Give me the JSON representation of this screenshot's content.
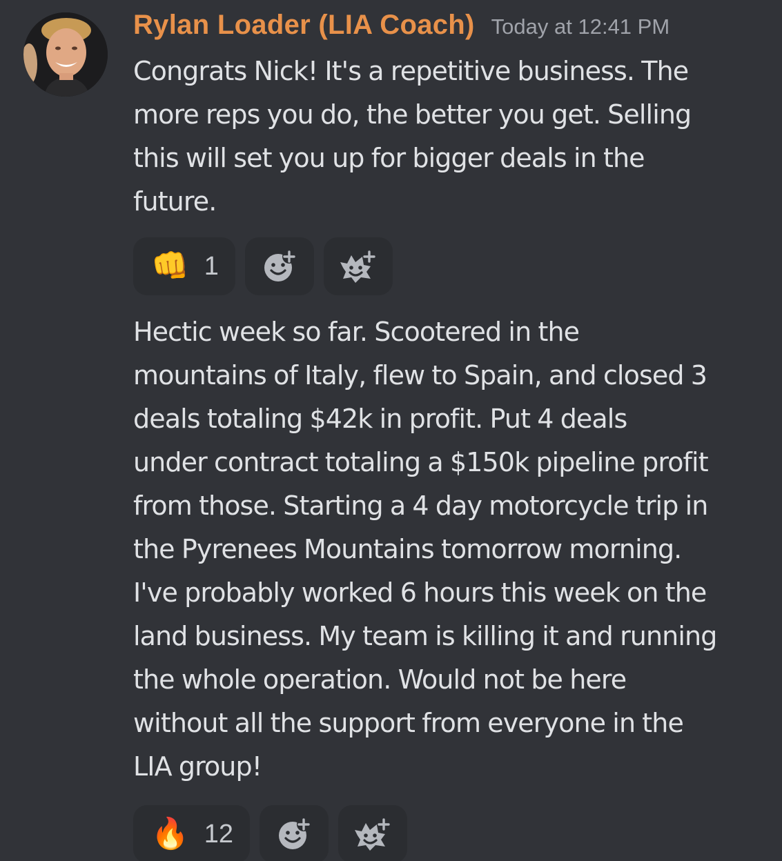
{
  "message": {
    "author": "Rylan Loader (LIA Coach)",
    "timestamp": "Today at 12:41 PM",
    "author_color": "#e8914a",
    "avatar": "avatar-photo"
  },
  "posts": [
    {
      "text": "Congrats Nick! It's a repetitive business. The\nmore reps you do, the better you get. Selling\nthis will set you up for bigger deals in the\nfuture.",
      "reaction": {
        "emoji": "👊",
        "icon": "fist-bump-icon",
        "count": "1"
      }
    },
    {
      "text": "Hectic week so far. Scootered in the\nmountains of Italy, flew to Spain, and closed 3\ndeals totaling $42k in profit. Put 4 deals\nunder contract totaling a $150k pipeline profit\nfrom those. Starting a 4 day motorcycle trip in\nthe Pyrenees Mountains tomorrow morning.\nI've probably worked 6 hours this week on the\nland business. My team is killing it and running\nthe whole operation. Would not be here\nwithout all the support from everyone in the\nLIA group!",
      "reaction": {
        "emoji": "🔥",
        "icon": "fire-icon",
        "count": "12"
      }
    }
  ],
  "actions": {
    "add_reaction_icon": "add-reaction-icon",
    "add_super_reaction_icon": "add-super-reaction-icon"
  }
}
